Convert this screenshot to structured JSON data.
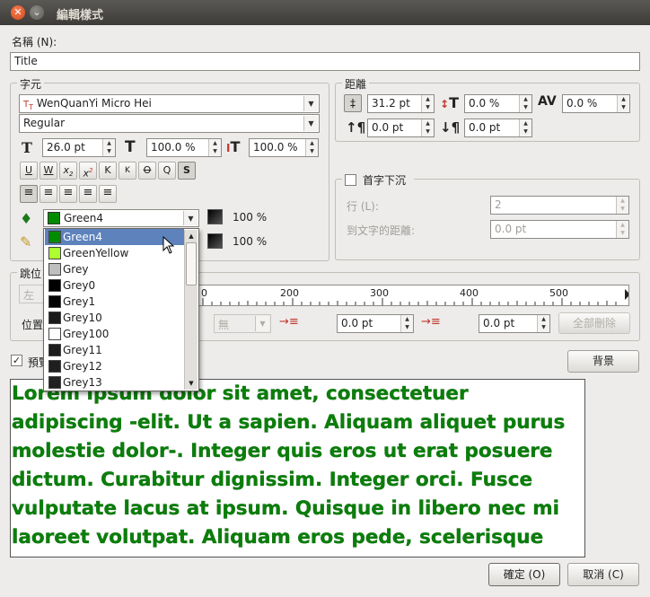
{
  "window": {
    "title": "編輯樣式"
  },
  "name_field": {
    "label": "名稱 (N):",
    "value": "Title"
  },
  "font_group": {
    "title": "字元",
    "font_name": "WenQuanYi Micro Hei",
    "font_style": "Regular",
    "size": "26.0 pt",
    "scale_width": "100.0 %",
    "scale_height": "100.0 %",
    "fill_color": "Green4",
    "fill_shade": "100 %",
    "stroke_shade": "100 %",
    "style_buttons": [
      "U",
      "W",
      "x",
      "x",
      "K",
      "K",
      "O",
      "Q",
      "S"
    ],
    "align_buttons": [
      "left",
      "center",
      "right",
      "justify",
      "force-justify"
    ]
  },
  "spacing_group": {
    "title": "距離",
    "line_spacing": "31.2 pt",
    "baseline_offset": "0.0 %",
    "tracking": "0.0 %",
    "space_above": "0.0 pt",
    "space_below": "0.0 pt"
  },
  "dropcap_group": {
    "title": "首字下沉",
    "lines_label": "行 (L):",
    "lines_value": "2",
    "distance_label": "到文字的距離:",
    "distance_value": "0.0 pt"
  },
  "tabs_group": {
    "title": "跳位",
    "align_value": "左",
    "position_label": "位置",
    "fill_label": "無",
    "ruler_marks": [
      "200",
      "300",
      "400",
      "500"
    ],
    "indent_first": "0.0 pt",
    "indent_left": "0.0 pt",
    "delete_all_label": "全部刪除"
  },
  "preview": {
    "checkbox_label": "預覽",
    "background_button": "背景",
    "text": "Lorem ipsum dolor sit amet, consectetuer adipiscing -elit. Ut a sapien. Aliquam aliquet purus molestie dolor-. Integer quis eros ut erat posuere dictum. Curabitur dignissim. Integer orci. Fusce vulputate lacus at ipsum. Quisque in libero nec mi laoreet volutpat. Aliquam eros pede, scelerisque quis, tristique cursus,"
  },
  "color_list": [
    {
      "name": "Green4",
      "color": "#008b00",
      "selected": true
    },
    {
      "name": "GreenYellow",
      "color": "#adff2f"
    },
    {
      "name": "Grey",
      "color": "#bebebe"
    },
    {
      "name": "Grey0",
      "color": "#000000"
    },
    {
      "name": "Grey1",
      "color": "#030303"
    },
    {
      "name": "Grey10",
      "color": "#1a1a1a"
    },
    {
      "name": "Grey100",
      "color": "#ffffff"
    },
    {
      "name": "Grey11",
      "color": "#1c1c1c"
    },
    {
      "name": "Grey12",
      "color": "#1f1f1f"
    },
    {
      "name": "Grey13",
      "color": "#212121"
    }
  ],
  "buttons": {
    "ok": "確定 (O)",
    "cancel": "取消 (C)"
  },
  "colors": {
    "selection": "#5d82bc",
    "preview_text": "#0a7f0a",
    "titlebar": "#3c3b37"
  }
}
